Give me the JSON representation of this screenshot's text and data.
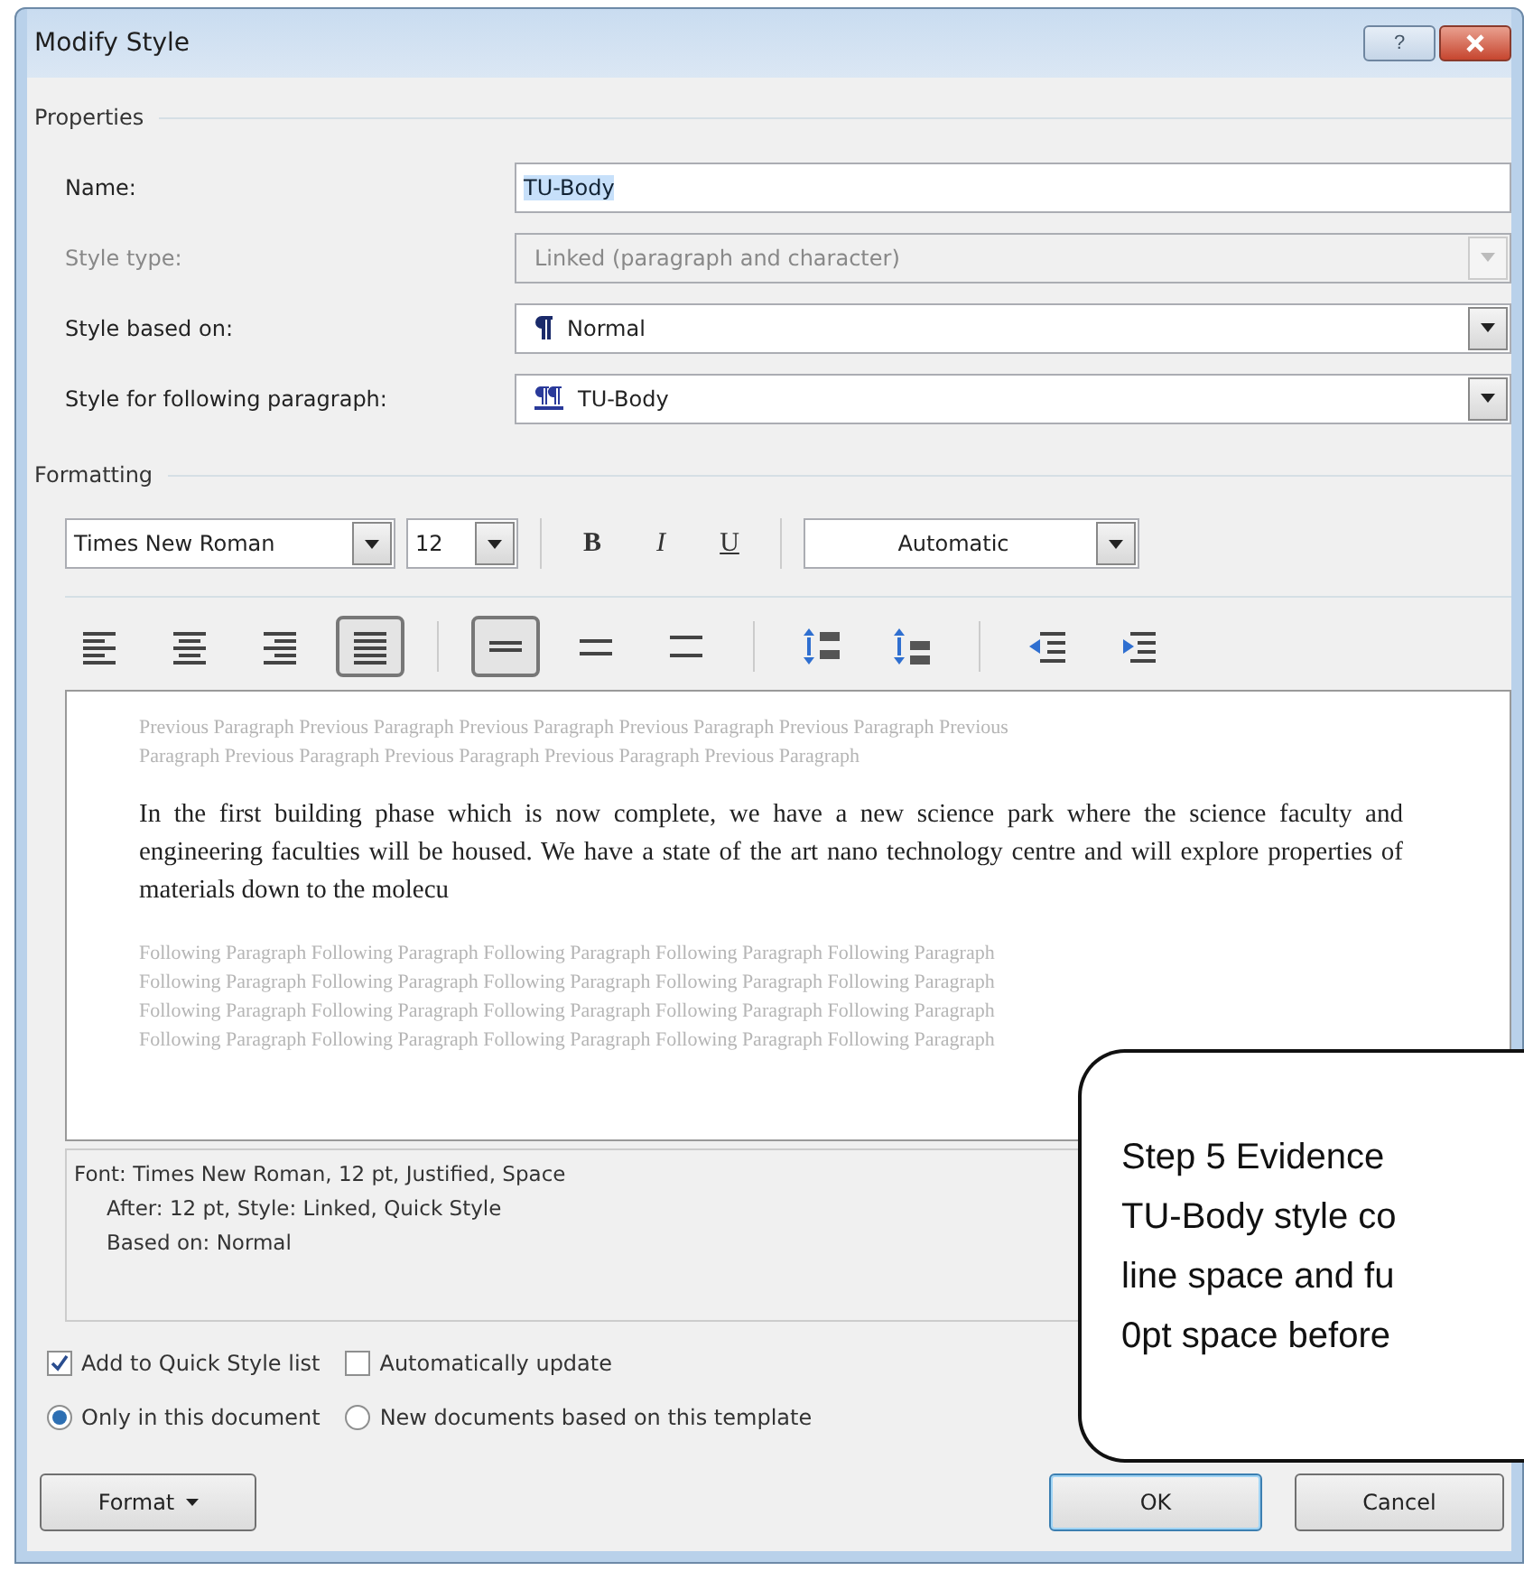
{
  "window": {
    "title": "Modify Style",
    "help_button": "?"
  },
  "properties": {
    "heading": "Properties",
    "rows": [
      {
        "label": "Name:",
        "kind": "text",
        "value": "TU-Body",
        "disabled": false
      },
      {
        "label": "Style type:",
        "kind": "combo",
        "value": "Linked (paragraph and character)",
        "disabled": true
      },
      {
        "label": "Style based on:",
        "kind": "paragraph-combo",
        "value": "Normal",
        "disabled": false
      },
      {
        "label": "Style for following paragraph:",
        "kind": "linked-combo",
        "value": "TU-Body",
        "disabled": false
      }
    ]
  },
  "formatting": {
    "heading": "Formatting",
    "font": "Times New Roman",
    "size": "12",
    "styles": [
      {
        "label": "B",
        "kind": "bold",
        "selected": false
      },
      {
        "label": "I",
        "kind": "italic",
        "selected": false
      },
      {
        "label": "U",
        "kind": "underline",
        "selected": false
      }
    ],
    "font_color_dropdown": "Automatic",
    "alignment": [
      {
        "kind": "left",
        "selected": false
      },
      {
        "kind": "center",
        "selected": false
      },
      {
        "kind": "right",
        "selected": false
      },
      {
        "kind": "justify",
        "selected": true
      }
    ],
    "spacing": [
      {
        "kind": "single",
        "selected": true
      },
      {
        "kind": "one-half",
        "selected": false
      },
      {
        "kind": "double",
        "selected": false
      }
    ],
    "paragraph_spacing": [
      {
        "kind": "space-before"
      },
      {
        "kind": "space-after"
      }
    ],
    "indent": [
      {
        "kind": "decrease"
      },
      {
        "kind": "increase"
      }
    ]
  },
  "preview": {
    "previous": [
      "Previous Paragraph Previous Paragraph Previous Paragraph Previous Paragraph Previous Paragraph Previous",
      "Paragraph Previous Paragraph Previous Paragraph Previous Paragraph Previous Paragraph"
    ],
    "sample": "In the first building phase which is now complete, we have a new science park where the science faculty and engineering faculties will be housed. We have a state of the art nano technology centre and will explore properties of materials down to the molecu",
    "following": [
      "Following Paragraph Following Paragraph Following Paragraph Following Paragraph Following Paragraph",
      "Following Paragraph Following Paragraph Following Paragraph Following Paragraph Following Paragraph",
      "Following Paragraph Following Paragraph Following Paragraph Following Paragraph Following Paragraph",
      "Following Paragraph Following Paragraph Following Paragraph Following Paragraph Following Paragraph"
    ]
  },
  "description": [
    "Font: Times New Roman, 12 pt, Justified, Space",
    "After:  12 pt, Style: Linked, Quick Style",
    "Based on: Normal"
  ],
  "checkboxes": [
    {
      "label": "Add to Quick Style list",
      "checked": true
    },
    {
      "label": "Automatically update",
      "checked": false
    }
  ],
  "radios": [
    {
      "label": "Only in this document",
      "selected": true
    },
    {
      "label": "New documents based on this template",
      "selected": false
    }
  ],
  "buttons": {
    "format": "Format",
    "ok": "OK",
    "cancel": "Cancel"
  },
  "callout": {
    "lines": [
      "Step 5 Evidence",
      "TU-Body style co",
      "line space and fu",
      "0pt space before"
    ]
  }
}
